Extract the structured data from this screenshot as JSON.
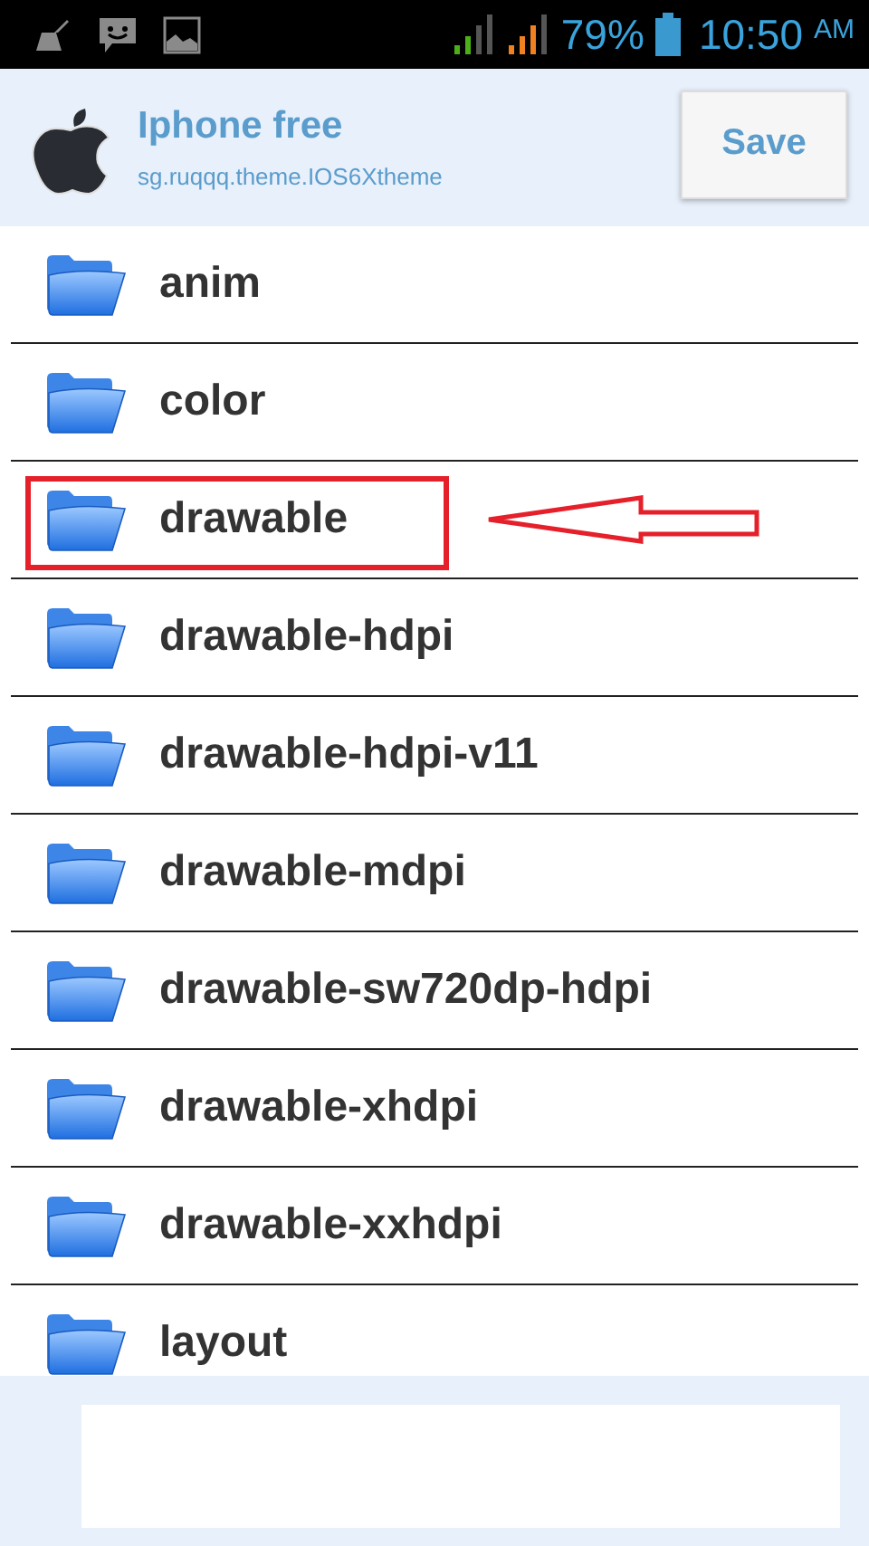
{
  "status_bar": {
    "battery": "79%",
    "time": "10:50",
    "meridiem": "AM"
  },
  "header": {
    "title": "Iphone free",
    "package": "sg.ruqqq.theme.IOS6Xtheme",
    "save_button": "Save"
  },
  "folders": [
    {
      "name": "anim",
      "highlighted": false
    },
    {
      "name": "color",
      "highlighted": false
    },
    {
      "name": "drawable",
      "highlighted": true
    },
    {
      "name": "drawable-hdpi",
      "highlighted": false
    },
    {
      "name": "drawable-hdpi-v11",
      "highlighted": false
    },
    {
      "name": "drawable-mdpi",
      "highlighted": false
    },
    {
      "name": "drawable-sw720dp-hdpi",
      "highlighted": false
    },
    {
      "name": "drawable-xhdpi",
      "highlighted": false
    },
    {
      "name": "drawable-xxhdpi",
      "highlighted": false
    },
    {
      "name": "layout",
      "highlighted": false
    }
  ]
}
